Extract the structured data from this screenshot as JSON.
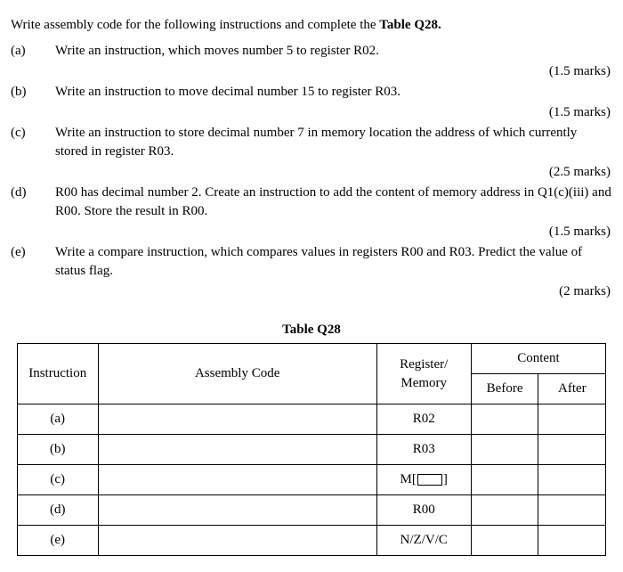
{
  "intro": "Write assembly code for the following instructions and complete the ",
  "intro_bold": "Table Q28.",
  "questions": {
    "a": {
      "label": "(a)",
      "text": "Write an instruction, which moves number 5 to register R02.",
      "marks": "(1.5 marks)"
    },
    "b": {
      "label": "(b)",
      "text": "Write an instruction to move decimal number 15 to register R03.",
      "marks": "(1.5 marks)"
    },
    "c": {
      "label": "(c)",
      "text": "Write an instruction to store decimal number 7 in memory location the address of which currently stored in register R03.",
      "marks": "(2.5 marks)"
    },
    "d": {
      "label": "(d)",
      "text": "R00 has decimal number 2. Create an instruction to add the content of memory address in Q1(c)(iii) and R00. Store the result in R00.",
      "marks": "(1.5 marks)"
    },
    "e": {
      "label": "(e)",
      "text": "Write a compare instruction, which compares values in registers R00 and R03. Predict the value of status flag.",
      "marks": "(2 marks)"
    }
  },
  "table": {
    "title": "Table Q28",
    "headers": {
      "instruction": "Instruction",
      "assembly_code": "Assembly Code",
      "register_memory": "Register/ Memory",
      "content": "Content",
      "before": "Before",
      "after": "After"
    },
    "rows": [
      {
        "instr": "(a)",
        "asm": "",
        "regmem": "R02",
        "before": "",
        "after": ""
      },
      {
        "instr": "(b)",
        "asm": "",
        "regmem": "R03",
        "before": "",
        "after": ""
      },
      {
        "instr": "(c)",
        "asm": "",
        "regmem_prefix": "M[",
        "regmem_suffix": "]",
        "before": "",
        "after": ""
      },
      {
        "instr": "(d)",
        "asm": "",
        "regmem": "R00",
        "before": "",
        "after": ""
      },
      {
        "instr": "(e)",
        "asm": "",
        "regmem": "N/Z/V/C",
        "before": "",
        "after": ""
      }
    ]
  }
}
